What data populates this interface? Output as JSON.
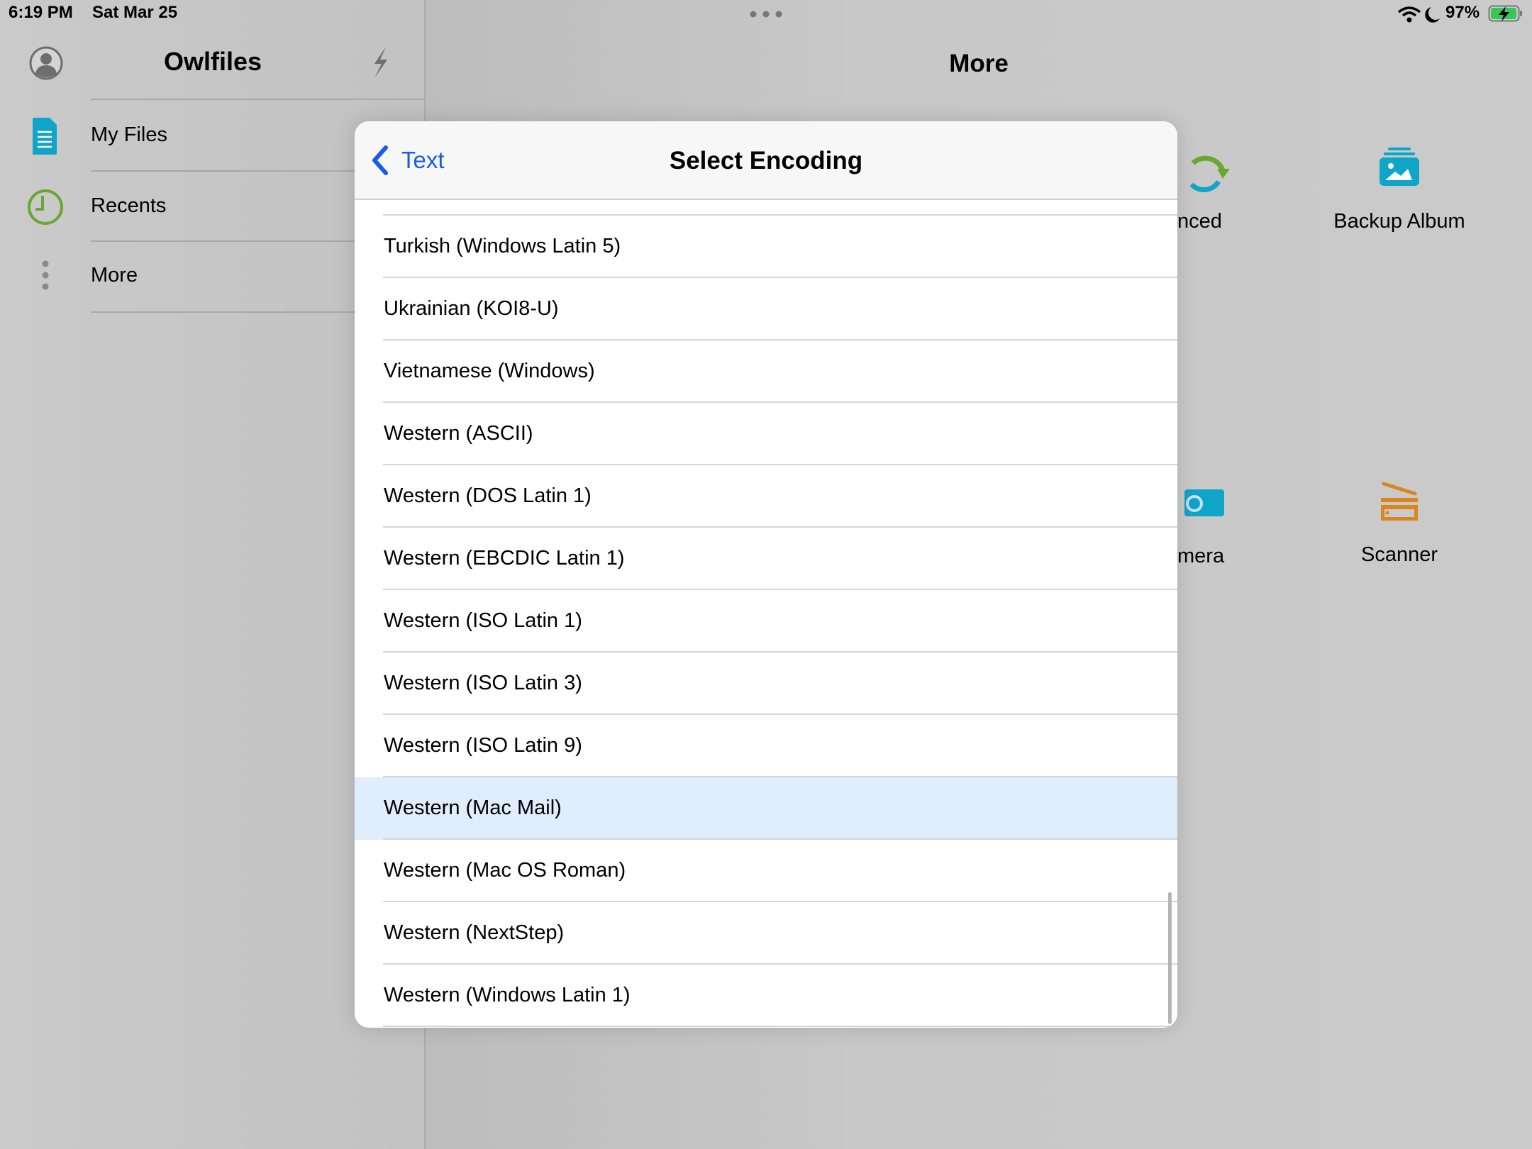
{
  "status_bar": {
    "time": "6:19 PM",
    "date": "Sat Mar 25",
    "battery": "97%",
    "battery_level": 0.97
  },
  "sidebar": {
    "title": "Owlfiles",
    "items": [
      {
        "label": "My Files",
        "icon": "document-icon"
      },
      {
        "label": "Recents",
        "icon": "clock-icon"
      },
      {
        "label": "More",
        "icon": "more-vertical-icon"
      }
    ]
  },
  "main": {
    "title": "More",
    "grid": [
      {
        "label_visible": "nced",
        "icon": "sync-icon"
      },
      {
        "label": "Backup Album",
        "icon": "photo-album-icon"
      },
      {
        "label_visible": "mera",
        "icon": "camera-icon"
      },
      {
        "label": "Scanner",
        "icon": "scanner-icon"
      }
    ]
  },
  "modal": {
    "title": "Select Encoding",
    "back_label": "Text",
    "selected": "Western (Mac Mail)",
    "selected_color": "#dfedfd",
    "items": [
      "Turkish (Windows Latin 5)",
      "Ukrainian (KOI8-U)",
      "Vietnamese (Windows)",
      "Western (ASCII)",
      "Western (DOS Latin 1)",
      "Western (EBCDIC Latin 1)",
      "Western (ISO Latin 1)",
      "Western (ISO Latin 3)",
      "Western (ISO Latin 9)",
      "Western (Mac Mail)",
      "Western (Mac OS Roman)",
      "Western (NextStep)",
      "Western (Windows Latin 1)"
    ]
  }
}
